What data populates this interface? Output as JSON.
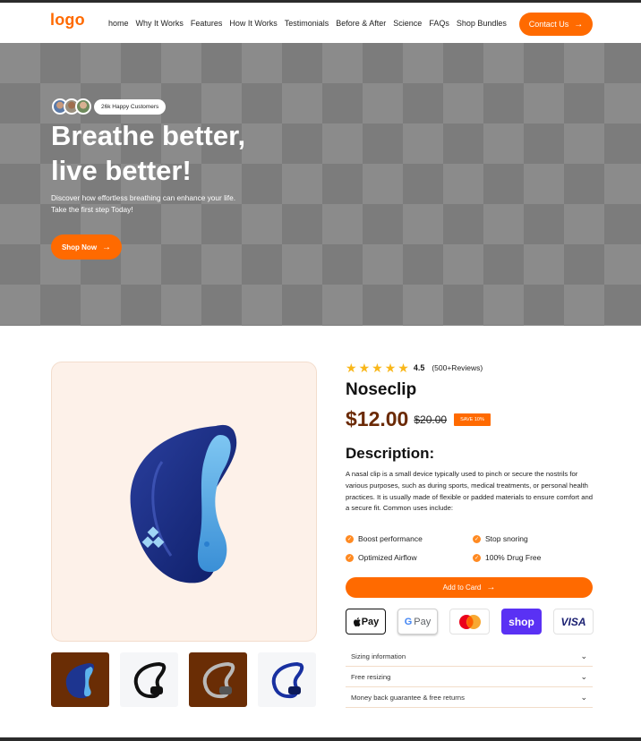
{
  "header": {
    "logo": "logo",
    "nav": [
      "home",
      "Why It Works",
      "Features",
      "How It Works",
      "Testimonials",
      "Before & After",
      "Science",
      "FAQs",
      "Shop Bundles"
    ],
    "contact_label": "Contact Us"
  },
  "hero": {
    "customers_label": "26k Happy Customers",
    "title_line1": "Breathe better,",
    "title_line2": "live better!",
    "subtitle_line1": "Discover how effortless breathing can enhance your life.",
    "subtitle_line2": "Take the first step Today!",
    "cta_label": "Shop Now"
  },
  "product": {
    "rating": "4.5",
    "reviews": "(500+Reviews)",
    "stars": 5,
    "title": "Noseclip",
    "price": "$12.00",
    "old_price": "$20.00",
    "save_badge": "SAVE 10%",
    "description_title": "Description:",
    "description": "A nasal clip is a small device typically used to pinch or secure the nostrils for various purposes, such as during sports, medical treatments, or personal health practices. It is usually made of flexible or padded materials to ensure comfort and a secure fit. Common uses include:",
    "features": [
      "Boost performance",
      "Stop snoring",
      "Optimized Airflow",
      "100% Drug Free"
    ],
    "cart_label": "Add to Card",
    "payments": {
      "apple": "Pay",
      "google": "Pay",
      "shop": "shop",
      "visa": "VISA"
    },
    "accordion": [
      "Sizing information",
      "Free resizing",
      "Money back guarantee & free returns"
    ]
  },
  "colors": {
    "accent": "#ff6a00",
    "price": "#6b2a05",
    "thumb_brown": "#6a2d05",
    "image_bg": "#fdf1e9"
  }
}
